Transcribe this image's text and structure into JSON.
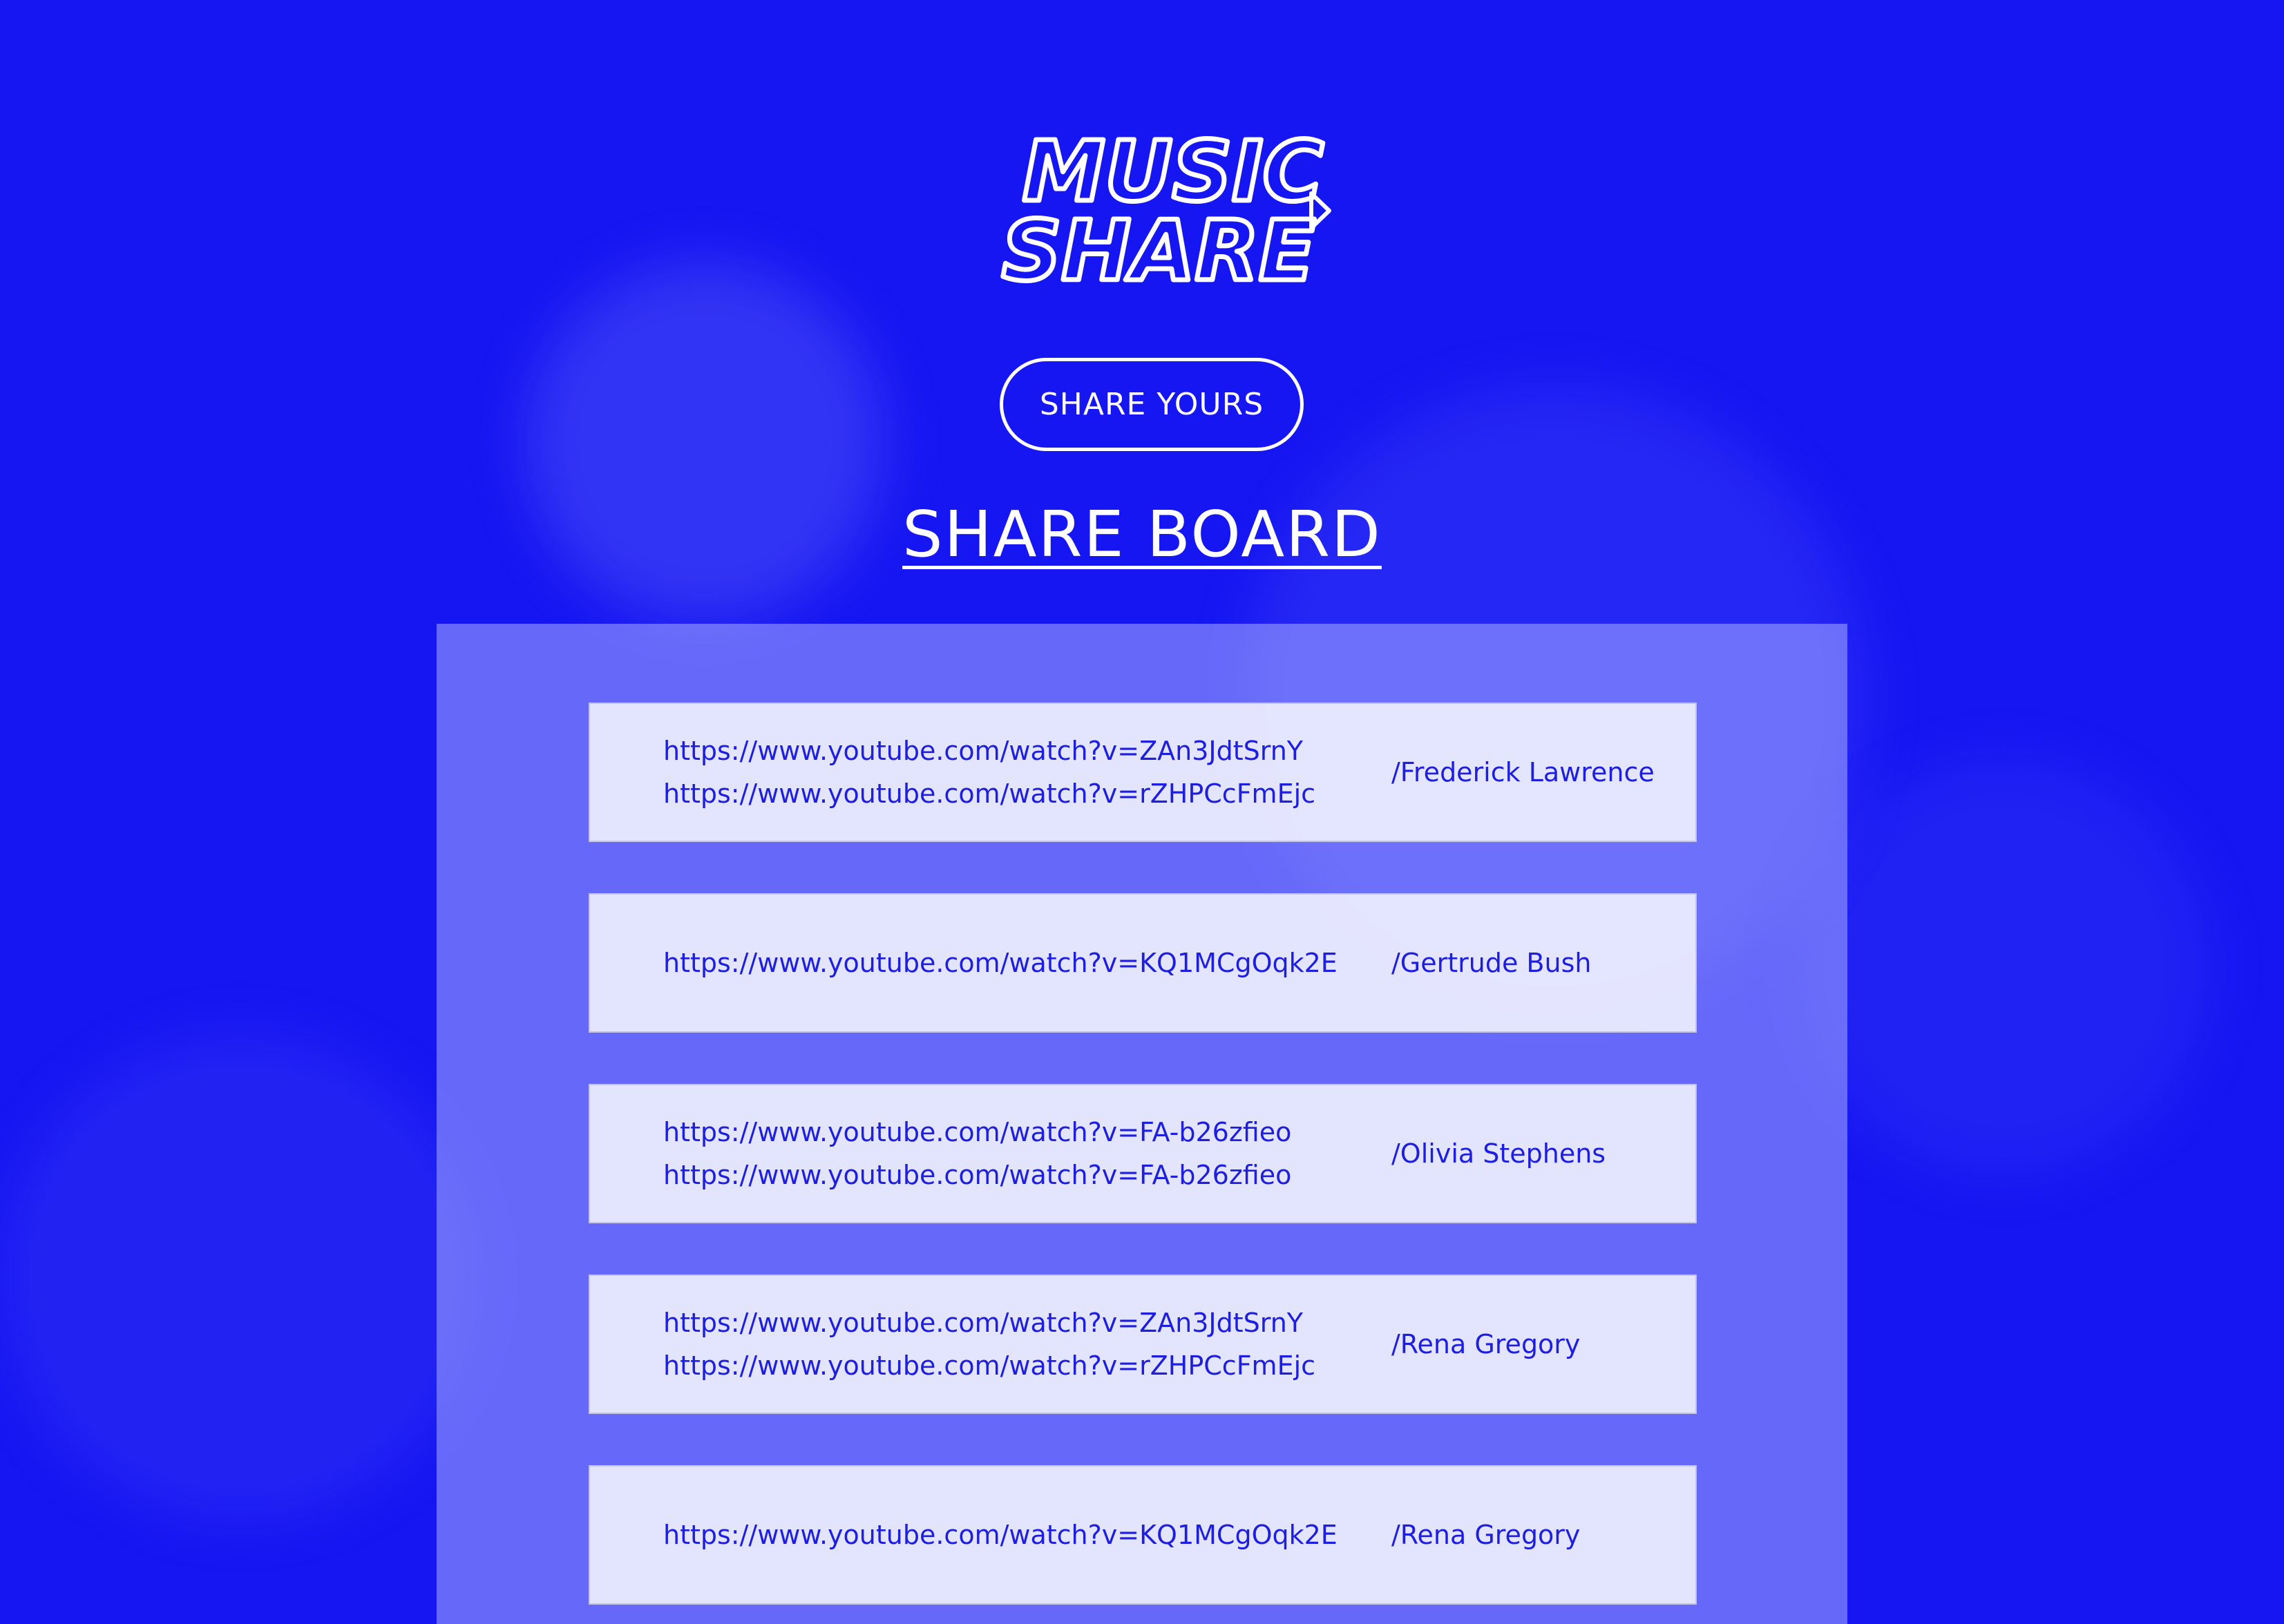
{
  "logo": {
    "line1": "MUSIC",
    "line2": "SHARE",
    "icon": "play-arrow-icon"
  },
  "share_button": {
    "label": "SHARE YOURS"
  },
  "board": {
    "title": "SHARE BOARD",
    "entries": [
      {
        "links": [
          "https://www.youtube.com/watch?v=ZAn3JdtSrnY",
          "https://www.youtube.com/watch?v=rZHPCcFmEjc"
        ],
        "author": "/Frederick Lawrence"
      },
      {
        "links": [
          "https://www.youtube.com/watch?v=KQ1MCgOqk2E"
        ],
        "author": "/Gertrude Bush"
      },
      {
        "links": [
          "https://www.youtube.com/watch?v=FA-b26zfieo",
          "https://www.youtube.com/watch?v=FA-b26zfieo"
        ],
        "author": "/Olivia Stephens"
      },
      {
        "links": [
          "https://www.youtube.com/watch?v=ZAn3JdtSrnY",
          "https://www.youtube.com/watch?v=rZHPCcFmEjc"
        ],
        "author": "/Rena Gregory"
      },
      {
        "links": [
          "https://www.youtube.com/watch?v=KQ1MCgOqk2E"
        ],
        "author": "/Rena Gregory"
      }
    ]
  },
  "colors": {
    "background": "#1616f2",
    "accent_text": "#1e1ee0",
    "white": "#ffffff"
  }
}
